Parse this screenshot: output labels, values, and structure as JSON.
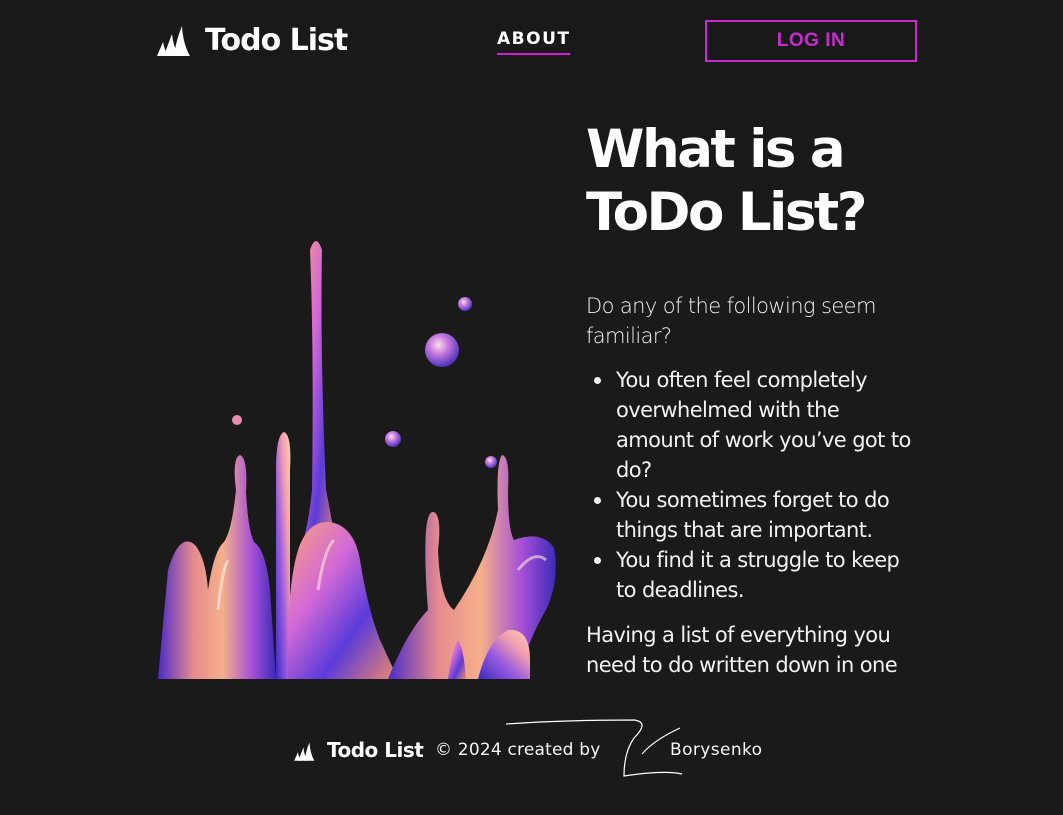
{
  "header": {
    "brand": "Todo List",
    "nav_about": "ABOUT",
    "login_label": "LOG IN"
  },
  "main": {
    "headline_line1": "What is a",
    "headline_line2": "ToDo List?",
    "intro": "Do any of the following seem familiar?",
    "bullets": [
      "You often feel completely overwhelmed with the amount of work you’ve got to do?",
      "You sometimes forget to do things that are important.",
      "You find it a struggle to keep to deadlines."
    ],
    "outro": "Having a list of everything you need to do written down in one"
  },
  "footer": {
    "brand": "Todo List",
    "credit": "© 2024 created by",
    "author": "Borysenko"
  },
  "icons": {
    "logo": "todo-list-logo-icon",
    "bullet": "bullet-dot",
    "signature": "signature-scribble"
  },
  "colors": {
    "background": "#1a1919",
    "accent": "#c72bd0",
    "text": "#ffffff"
  }
}
